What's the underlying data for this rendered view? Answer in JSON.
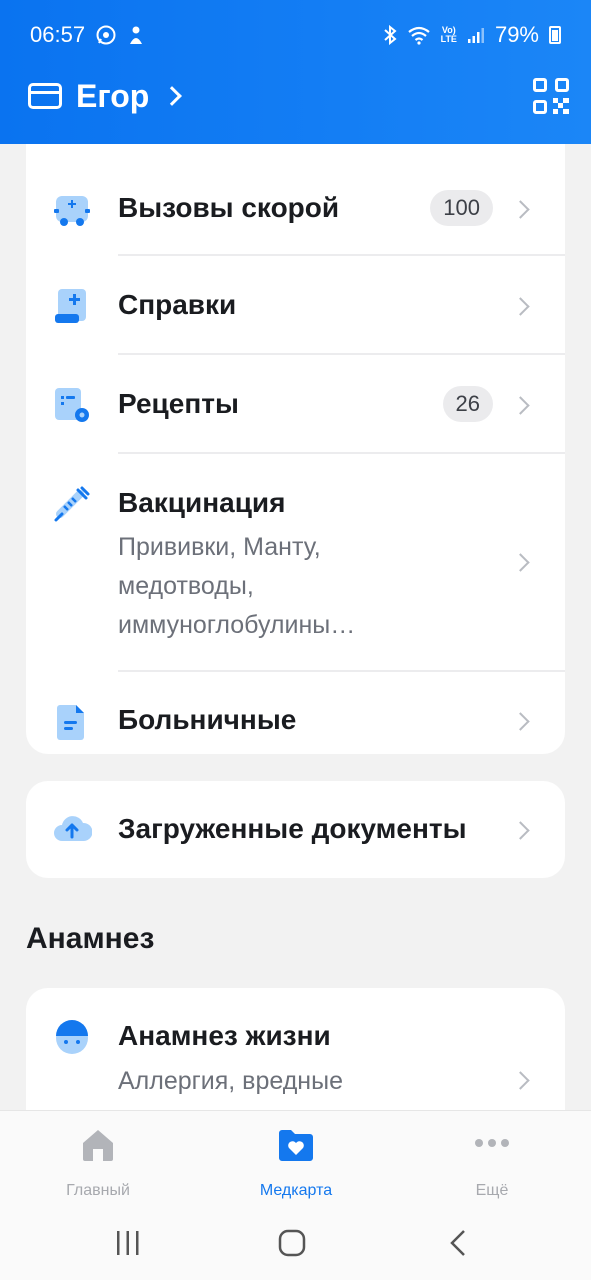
{
  "status_bar": {
    "time": "06:57",
    "battery": "79%",
    "network_label": "LTE",
    "volte_label": "Vo)"
  },
  "header": {
    "profile_name": "Егор"
  },
  "colors": {
    "brand_blue": "#1478ee",
    "header_gradient_start": "#0a73f0",
    "header_gradient_end": "#1b86f7",
    "badge_bg": "#ebebed"
  },
  "medical_records": {
    "items": [
      {
        "title": "Вызовы скорой",
        "badge": "100",
        "icon": "ambulance-icon"
      },
      {
        "title": "Справки",
        "icon": "certificate-icon"
      },
      {
        "title": "Рецепты",
        "badge": "26",
        "icon": "prescription-icon"
      },
      {
        "title": "Вакцинация",
        "subtitle": "Прививки, Манту, медотводы, иммуноглобулины…",
        "icon": "syringe-icon"
      },
      {
        "title": "Больничные",
        "icon": "sick-leave-document-icon"
      }
    ]
  },
  "uploaded_documents": {
    "title": "Загруженные документы",
    "icon": "cloud-upload-icon"
  },
  "anamnesis": {
    "section_title": "Анамнез",
    "items": [
      {
        "title": "Анамнез жизни",
        "subtitle": "Аллергия, вредные",
        "icon": "person-icon"
      }
    ]
  },
  "bottom_nav": {
    "items": [
      {
        "label": "Главный",
        "icon": "home-icon",
        "active": false
      },
      {
        "label": "Медкарта",
        "icon": "medcard-folder-icon",
        "active": true
      },
      {
        "label": "Ещё",
        "icon": "more-icon",
        "active": false
      }
    ]
  }
}
